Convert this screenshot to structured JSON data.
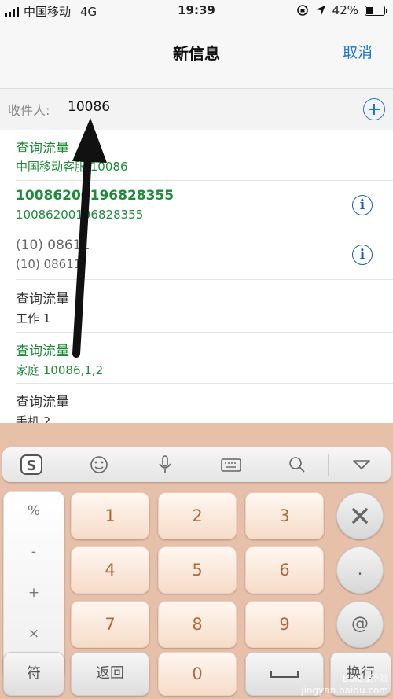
{
  "status_bar": {
    "carrier": "中国移动",
    "network": "4G",
    "time": "19:39",
    "battery": "42%",
    "battery_level": 0.42
  },
  "nav": {
    "title": "新信息",
    "cancel": "取消"
  },
  "recipient": {
    "label": "收件人:",
    "value": "10086"
  },
  "suggestions": [
    {
      "title": "查询流量",
      "detail": "中国移动客服 10086",
      "style": "green"
    },
    {
      "title": "10086200196828355",
      "detail": "10086200196828355",
      "style": "green-bold"
    },
    {
      "title": "(10) 08611",
      "detail": "(10) 08611",
      "style": "grey"
    },
    {
      "title": "查询流量",
      "detail": "工作  1",
      "style": "dark"
    },
    {
      "title": "查询流量",
      "detail": "家庭  10086,1,2",
      "style": "green"
    },
    {
      "title": "查询流量",
      "detail": "手机  2",
      "style": "dark"
    }
  ],
  "keyboard": {
    "toolbar_icons": [
      "sogou-logo-icon",
      "emoji-icon",
      "microphone-icon",
      "keyboard-icon",
      "search-icon",
      "collapse-icon"
    ],
    "symbols": [
      "%",
      "-",
      "+",
      "×"
    ],
    "digits": [
      "1",
      "2",
      "3",
      "4",
      "5",
      "6",
      "7",
      "8",
      "9"
    ],
    "zero": "0",
    "dot": ".",
    "at": "@",
    "symbol_key": "符",
    "back_key": "返回",
    "newline_key": "换行",
    "watermark": "Baidu经验\njingyan.baidu.com"
  }
}
